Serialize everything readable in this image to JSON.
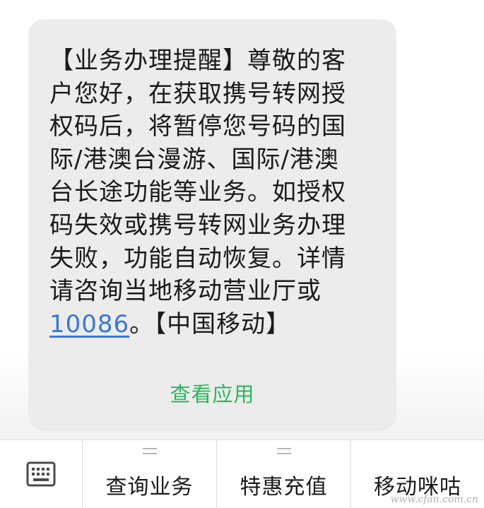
{
  "message": {
    "lines": [
      "【业务办理提醒】尊敬的客",
      "户您好，在获取携号转网授",
      "权码后，将暂停您号码的国",
      "际/港澳台漫游、国际/港澳",
      "台长途功能等业务。如授权",
      "码失效或携号转网业务办理",
      "失败，功能自动恢复。详情",
      "请咨询当地移动营业厅或"
    ],
    "phone_link": "10086",
    "signature": "。【中国移动】",
    "action_label": "查看应用"
  },
  "bottom_menu": {
    "keyboard_icon": "keyboard-icon",
    "items": [
      {
        "label": "查询业务"
      },
      {
        "label": "特惠充值"
      },
      {
        "label": "移动咪咕"
      }
    ]
  },
  "watermark": "www.cfan.com.cn",
  "colors": {
    "bubble": "#ececec",
    "link": "#3978d4",
    "action": "#2db45e"
  }
}
